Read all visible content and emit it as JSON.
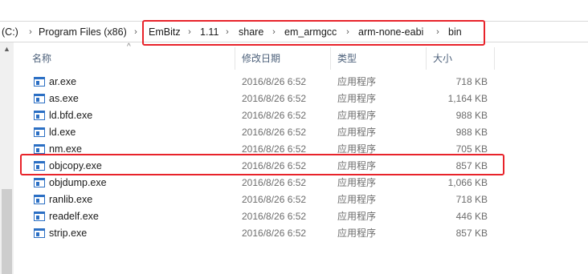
{
  "breadcrumbs": [
    "(C:)",
    "Program Files (x86)",
    "EmBitz",
    "1.11",
    "share",
    "em_armgcc",
    "arm-none-eabi",
    "bin"
  ],
  "separator": "›",
  "columns": {
    "name": "名称",
    "date": "修改日期",
    "type": "类型",
    "size": "大小"
  },
  "files": [
    {
      "name": "ar.exe",
      "date": "2016/8/26 6:52",
      "type": "应用程序",
      "size": "718 KB"
    },
    {
      "name": "as.exe",
      "date": "2016/8/26 6:52",
      "type": "应用程序",
      "size": "1,164 KB"
    },
    {
      "name": "ld.bfd.exe",
      "date": "2016/8/26 6:52",
      "type": "应用程序",
      "size": "988 KB"
    },
    {
      "name": "ld.exe",
      "date": "2016/8/26 6:52",
      "type": "应用程序",
      "size": "988 KB"
    },
    {
      "name": "nm.exe",
      "date": "2016/8/26 6:52",
      "type": "应用程序",
      "size": "705 KB"
    },
    {
      "name": "objcopy.exe",
      "date": "2016/8/26 6:52",
      "type": "应用程序",
      "size": "857 KB"
    },
    {
      "name": "objdump.exe",
      "date": "2016/8/26 6:52",
      "type": "应用程序",
      "size": "1,066 KB"
    },
    {
      "name": "ranlib.exe",
      "date": "2016/8/26 6:52",
      "type": "应用程序",
      "size": "718 KB"
    },
    {
      "name": "readelf.exe",
      "date": "2016/8/26 6:52",
      "type": "应用程序",
      "size": "446 KB"
    },
    {
      "name": "strip.exe",
      "date": "2016/8/26 6:52",
      "type": "应用程序",
      "size": "857 KB"
    }
  ],
  "colors": {
    "highlight": "#e8232a",
    "icon": "#2b6fc4",
    "header_text": "#4c607a"
  },
  "icons": {
    "file": "exe-file-icon",
    "scroll_up": "scroll-up-arrow-icon",
    "sort": "sort-ascending-icon"
  }
}
